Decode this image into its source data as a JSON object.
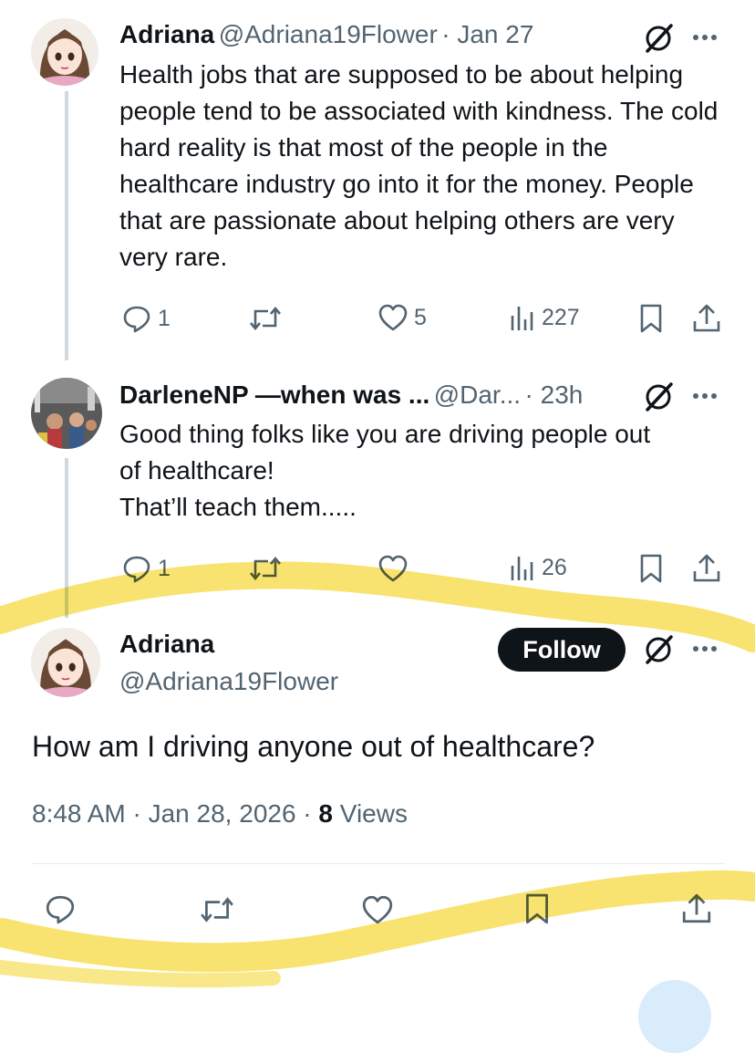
{
  "tweets": [
    {
      "name": "Adriana",
      "handle": "@Adriana19Flower",
      "time": "· Jan 27",
      "text": "Health jobs that are supposed to be about helping people tend to be associated with kindness. The cold hard reality is that most of the people in the healthcare industry go into it for the money. People that are passionate about helping others are very very rare.",
      "replies": "1",
      "likes": "5",
      "views": "227"
    },
    {
      "name": "DarleneNP —when was ...",
      "handle": "@Dar...",
      "time": "· 23h",
      "text_lines": [
        "Good thing folks like you are driving people out",
        "of healthcare!",
        "That’ll teach them....."
      ],
      "replies": "1",
      "views": "26"
    }
  ],
  "main_tweet": {
    "name": "Adriana",
    "handle": "@Adriana19Flower",
    "follow_label": "Follow",
    "text": "How am I driving anyone out of healthcare?",
    "timestamp": "8:48 AM · Jan 28, 2026 · ",
    "views_count": "8",
    "views_label": " Views"
  },
  "colors": {
    "text": "#0f1419",
    "secondary": "#536471",
    "highlight": "#f7de57"
  },
  "icons": [
    "grok-icon",
    "more-icon",
    "reply-icon",
    "retweet-icon",
    "like-icon",
    "views-icon",
    "bookmark-icon",
    "share-icon"
  ]
}
